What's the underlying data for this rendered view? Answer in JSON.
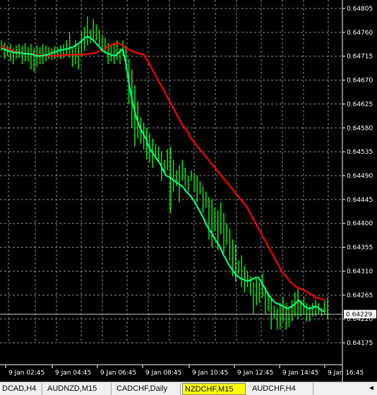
{
  "price_axis": {
    "labels": [
      "0.64805",
      "0.64760",
      "0.64715",
      "0.64670",
      "0.64625",
      "0.64580",
      "0.64535",
      "0.64490",
      "0.64445",
      "0.64400",
      "0.64355",
      "0.64310",
      "0.64265",
      "0.64220",
      "0.64175"
    ],
    "current_price": "0.64229",
    "current_price_value": 0.64229
  },
  "time_axis": {
    "labels": [
      "9 Jan 02:45",
      "9 Jan 04:45",
      "9 Jan 06:45",
      "9 Jan 08:45",
      "9 Jan 10:45",
      "9 Jan 12:45",
      "9 Jan 14:45",
      "9 Jan 16:45"
    ]
  },
  "colors": {
    "background": "#000000",
    "bars": "#00ff00",
    "fast_ma": "#00ff7f",
    "slow_ma": "#ff0000",
    "grid": "#8a8a8a",
    "price_line": "#c0c0c0",
    "active_tab": "#ffff00"
  },
  "tabs": [
    {
      "label": "DCAD,H4",
      "active": false
    },
    {
      "label": "AUDNZD,M15",
      "active": false
    },
    {
      "label": "CADCHF,Daily",
      "active": false
    },
    {
      "label": "NZDCHF,M15",
      "active": true
    },
    {
      "label": "AUDCHF,H4",
      "active": false
    }
  ],
  "scroll_arrow": "◄",
  "chart_data": {
    "type": "line",
    "ylim": [
      0.64175,
      0.64805
    ],
    "y_ticks": [
      0.64805,
      0.6476,
      0.64715,
      0.6467,
      0.64625,
      0.6458,
      0.64535,
      0.6449,
      0.64445,
      0.644,
      0.64355,
      0.6431,
      0.64265,
      0.6422,
      0.64175
    ],
    "bar_ranges": [
      [
        0.64745,
        0.64725
      ],
      [
        0.6474,
        0.6471
      ],
      [
        0.64735,
        0.64715
      ],
      [
        0.64738,
        0.64705
      ],
      [
        0.6473,
        0.647
      ],
      [
        0.64735,
        0.6471
      ],
      [
        0.64738,
        0.64712
      ],
      [
        0.64735,
        0.647
      ],
      [
        0.6474,
        0.64705
      ],
      [
        0.64732,
        0.64705
      ],
      [
        0.64738,
        0.6469
      ],
      [
        0.6473,
        0.64685
      ],
      [
        0.64735,
        0.64695
      ],
      [
        0.64732,
        0.647
      ],
      [
        0.64738,
        0.647
      ],
      [
        0.64735,
        0.64705
      ],
      [
        0.64732,
        0.6471
      ],
      [
        0.6473,
        0.64708
      ],
      [
        0.64734,
        0.6471
      ],
      [
        0.64732,
        0.64712
      ],
      [
        0.64736,
        0.6471
      ],
      [
        0.64738,
        0.64712
      ],
      [
        0.64745,
        0.64715
      ],
      [
        0.6476,
        0.64712
      ],
      [
        0.6473,
        0.64695
      ],
      [
        0.64745,
        0.647
      ],
      [
        0.64735,
        0.6469
      ],
      [
        0.6476,
        0.64715
      ],
      [
        0.6477,
        0.64725
      ],
      [
        0.6479,
        0.64735
      ],
      [
        0.64765,
        0.6474
      ],
      [
        0.64785,
        0.64745
      ],
      [
        0.64775,
        0.64745
      ],
      [
        0.64765,
        0.64735
      ],
      [
        0.64755,
        0.64725
      ],
      [
        0.6475,
        0.6472
      ],
      [
        0.6474,
        0.647
      ],
      [
        0.64735,
        0.64705
      ],
      [
        0.6474,
        0.647
      ],
      [
        0.64745,
        0.64708
      ],
      [
        0.6473,
        0.647
      ],
      [
        0.64745,
        0.64715
      ],
      [
        0.64735,
        0.6469
      ],
      [
        0.6471,
        0.64625
      ],
      [
        0.6469,
        0.6458
      ],
      [
        0.6466,
        0.64545
      ],
      [
        0.6463,
        0.6456
      ],
      [
        0.646,
        0.6455
      ],
      [
        0.6459,
        0.6454
      ],
      [
        0.6458,
        0.6452
      ],
      [
        0.6457,
        0.64515
      ],
      [
        0.6456,
        0.64505
      ],
      [
        0.6455,
        0.64525
      ],
      [
        0.64545,
        0.64515
      ],
      [
        0.64535,
        0.6448
      ],
      [
        0.6452,
        0.64495
      ],
      [
        0.6454,
        0.645
      ],
      [
        0.64545,
        0.6442
      ],
      [
        0.6452,
        0.6446
      ],
      [
        0.645,
        0.6447
      ],
      [
        0.6451,
        0.6444
      ],
      [
        0.6452,
        0.6448
      ],
      [
        0.64505,
        0.6447
      ],
      [
        0.6449,
        0.6446
      ],
      [
        0.645,
        0.6448
      ],
      [
        0.64495,
        0.6446
      ],
      [
        0.6449,
        0.6444
      ],
      [
        0.6448,
        0.64455
      ],
      [
        0.6447,
        0.6442
      ],
      [
        0.6446,
        0.6443
      ],
      [
        0.6445,
        0.6437
      ],
      [
        0.64445,
        0.64355
      ],
      [
        0.6443,
        0.64385
      ],
      [
        0.64425,
        0.6435
      ],
      [
        0.6444,
        0.6438
      ],
      [
        0.6442,
        0.64345
      ],
      [
        0.644,
        0.6436
      ],
      [
        0.6439,
        0.6433
      ],
      [
        0.6437,
        0.643
      ],
      [
        0.6436,
        0.6429
      ],
      [
        0.6433,
        0.64305
      ],
      [
        0.6434,
        0.6428
      ],
      [
        0.6432,
        0.6427
      ],
      [
        0.6431,
        0.6428
      ],
      [
        0.643,
        0.64265
      ],
      [
        0.6429,
        0.6423
      ],
      [
        0.64295,
        0.64245
      ],
      [
        0.6429,
        0.6425
      ],
      [
        0.64305,
        0.6426
      ],
      [
        0.6428,
        0.6423
      ],
      [
        0.6427,
        0.64235
      ],
      [
        0.6426,
        0.642
      ],
      [
        0.64245,
        0.6422
      ],
      [
        0.6424,
        0.642
      ],
      [
        0.6425,
        0.642
      ],
      [
        0.6426,
        0.64215
      ],
      [
        0.6425,
        0.642
      ],
      [
        0.6424,
        0.64205
      ],
      [
        0.64255,
        0.64215
      ],
      [
        0.6427,
        0.64225
      ],
      [
        0.6428,
        0.6422
      ],
      [
        0.64255,
        0.64225
      ],
      [
        0.6426,
        0.6423
      ],
      [
        0.6425,
        0.64215
      ],
      [
        0.64245,
        0.64215
      ],
      [
        0.6425,
        0.64225
      ],
      [
        0.64255,
        0.64225
      ],
      [
        0.6425,
        0.6423
      ],
      [
        0.6424,
        0.64225
      ],
      [
        0.64255,
        0.64228
      ],
      [
        0.6426,
        0.6422
      ]
    ],
    "series": [
      {
        "x_start": 0,
        "values": [
          0.64735,
          0.6473,
          0.64727,
          0.64724,
          0.64722,
          0.64721,
          0.6472,
          0.64719,
          0.64718,
          0.64717,
          0.64716,
          0.64716,
          0.64716,
          0.64716,
          0.64717,
          0.64717,
          0.64718,
          0.64718,
          0.64718,
          0.64718,
          0.64719,
          0.6472,
          0.64722,
          0.64726,
          0.6473,
          0.64735,
          0.64738,
          0.6474,
          0.64736,
          0.6473,
          0.64726,
          0.64722,
          0.6472,
          0.64718,
          0.64705,
          0.6469,
          0.64675,
          0.6466,
          0.64645,
          0.6463,
          0.64615,
          0.646,
          0.64585,
          0.64575,
          0.6456,
          0.6455,
          0.6454,
          0.6453,
          0.6452,
          0.6451,
          0.645,
          0.6449,
          0.6448,
          0.6447,
          0.6446,
          0.6445,
          0.6444,
          0.6443,
          0.64415,
          0.644,
          0.64385,
          0.6437,
          0.64355,
          0.6434,
          0.64325,
          0.6431,
          0.643,
          0.6429,
          0.64282,
          0.64278,
          0.64275,
          0.6427,
          0.64265,
          0.6426,
          0.64258,
          0.64255
        ]
      },
      {
        "x_start": 0,
        "values": [
          0.6473,
          0.64728,
          0.64726,
          0.64724,
          0.64722,
          0.64722,
          0.64722,
          0.64721,
          0.6472,
          0.6472,
          0.64719,
          0.64718,
          0.64716,
          0.64715,
          0.64716,
          0.64717,
          0.64718,
          0.6472,
          0.64722,
          0.64724,
          0.64726,
          0.64727,
          0.64728,
          0.64729,
          0.64731,
          0.64733,
          0.64736,
          0.6474,
          0.64745,
          0.6475,
          0.64752,
          0.64748,
          0.64744,
          0.64738,
          0.64732,
          0.64726,
          0.64722,
          0.6472,
          0.64718,
          0.64716,
          0.64718,
          0.64724,
          0.64728,
          0.64705,
          0.6467,
          0.6464,
          0.64615,
          0.64595,
          0.6458,
          0.6457,
          0.6456,
          0.64545,
          0.64535,
          0.64528,
          0.6452,
          0.64512,
          0.645,
          0.6449,
          0.64488,
          0.64484,
          0.6448,
          0.64476,
          0.64472,
          0.64468,
          0.6446,
          0.64455,
          0.64448,
          0.6444,
          0.6443,
          0.6442,
          0.6441,
          0.64398,
          0.64388,
          0.6438,
          0.6437,
          0.64362,
          0.64352,
          0.6434,
          0.6433,
          0.6432,
          0.64312,
          0.64305,
          0.643,
          0.64296,
          0.64294,
          0.64292,
          0.64292,
          0.64295,
          0.64298,
          0.64298,
          0.6429,
          0.6428,
          0.6427,
          0.64262,
          0.64255,
          0.6425,
          0.64248,
          0.64245,
          0.64242,
          0.6424,
          0.64242,
          0.64245,
          0.6425,
          0.64255,
          0.6425,
          0.64244,
          0.6424,
          0.6424,
          0.64242,
          0.64244,
          0.6424,
          0.64236,
          0.64234
        ]
      }
    ]
  }
}
